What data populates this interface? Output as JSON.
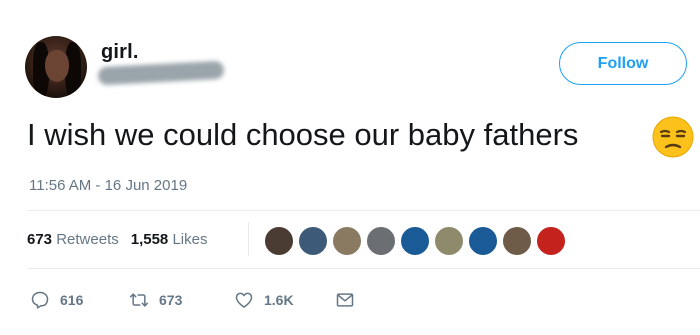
{
  "user": {
    "display_name": "girl.",
    "avatar_icon": "profile-photo-avatar"
  },
  "follow_button": {
    "label": "Follow",
    "color": "#1da1f2"
  },
  "tweet": {
    "text": "I wish we could choose our baby fathers",
    "emoji_icon": "unamused-face-emoji",
    "timestamp": "11:56 AM - 16 Jun 2019"
  },
  "stats": {
    "retweets_count": "673",
    "retweets_label": "Retweets",
    "likes_count": "1,558",
    "likes_label": "Likes"
  },
  "likers": [
    {
      "color": "#4a3b33"
    },
    {
      "color": "#3d5a78"
    },
    {
      "color": "#8a7a62"
    },
    {
      "color": "#6b6f73"
    },
    {
      "color": "#1a5a96"
    },
    {
      "color": "#8f8a6b"
    },
    {
      "color": "#1a5a96"
    },
    {
      "color": "#6e5c48"
    },
    {
      "color": "#c4221c"
    }
  ],
  "actions": {
    "replies": "616",
    "retweets": "673",
    "likes": "1.6K",
    "reply_icon": "reply-icon",
    "retweet_icon": "retweet-icon",
    "like_icon": "heart-icon",
    "message_icon": "envelope-icon"
  }
}
